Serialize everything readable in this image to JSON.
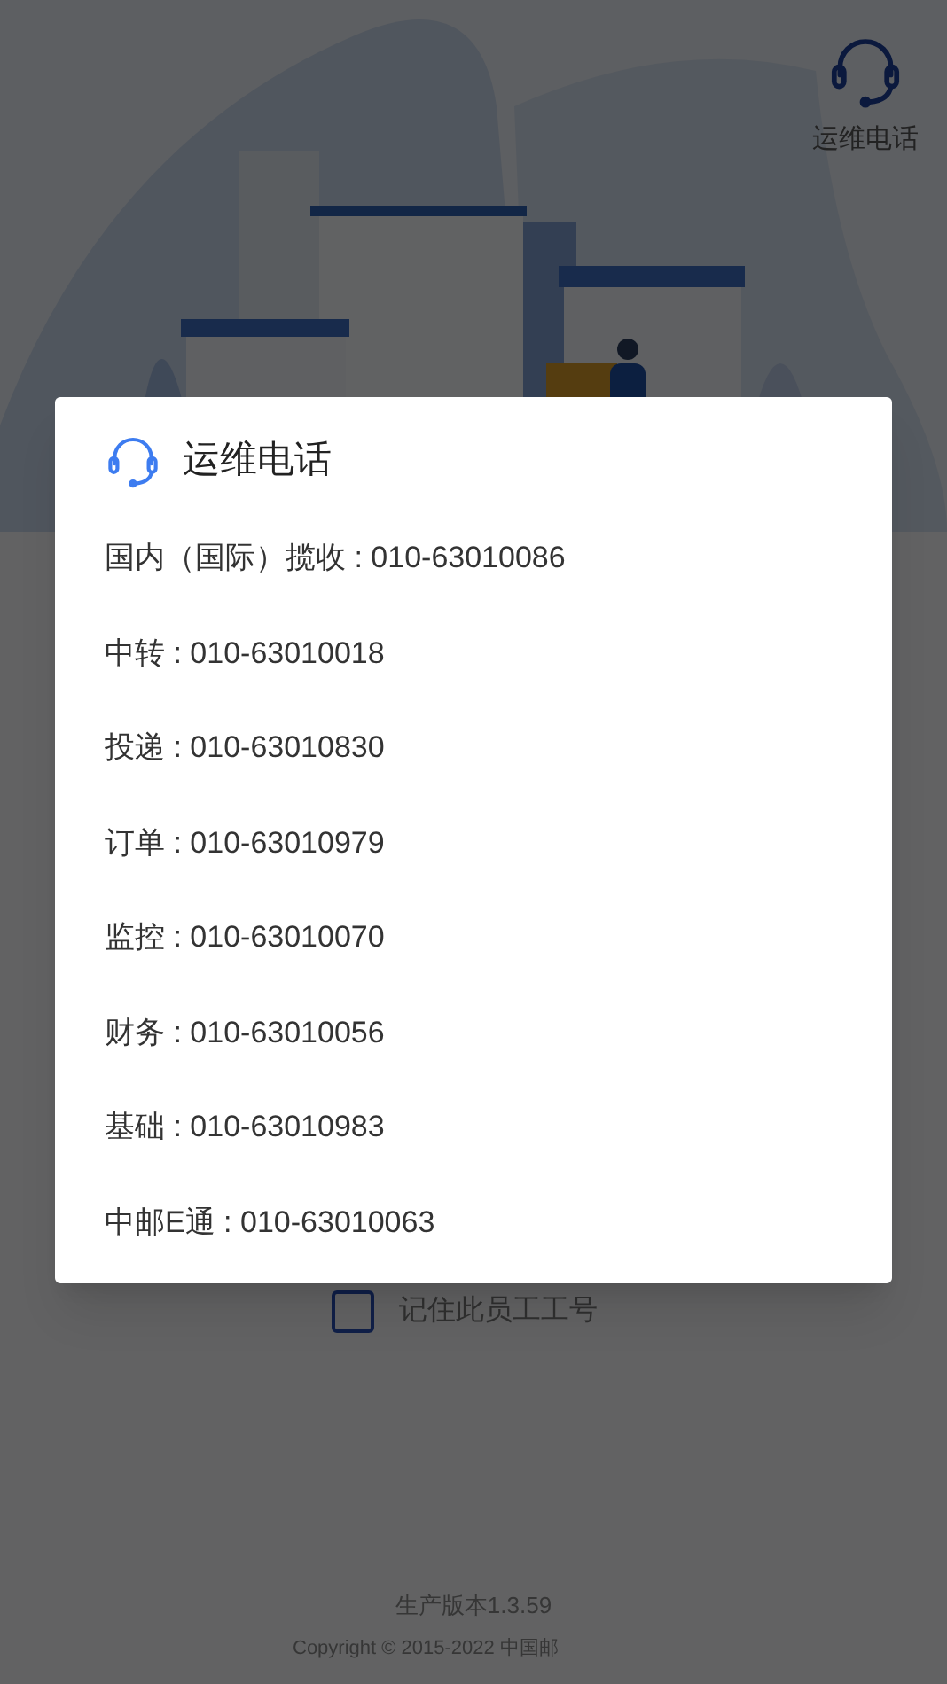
{
  "header": {
    "support_label": "运维电话"
  },
  "dialog": {
    "title": "运维电话",
    "lines": [
      "国内（国际）揽收 : 010-63010086",
      "中转 : 010-63010018",
      "投递 : 010-63010830",
      "订单 : 010-63010979",
      "监控 : 010-63010070",
      "财务 : 010-63010056",
      "基础 : 010-63010983",
      "中邮E通 : 010-63010063"
    ]
  },
  "remember": {
    "label": "记住此员工工号",
    "checked": false
  },
  "footer": {
    "version": "生产版本1.3.59",
    "copyright": "Copyright © 2015-2022 中国邮"
  }
}
